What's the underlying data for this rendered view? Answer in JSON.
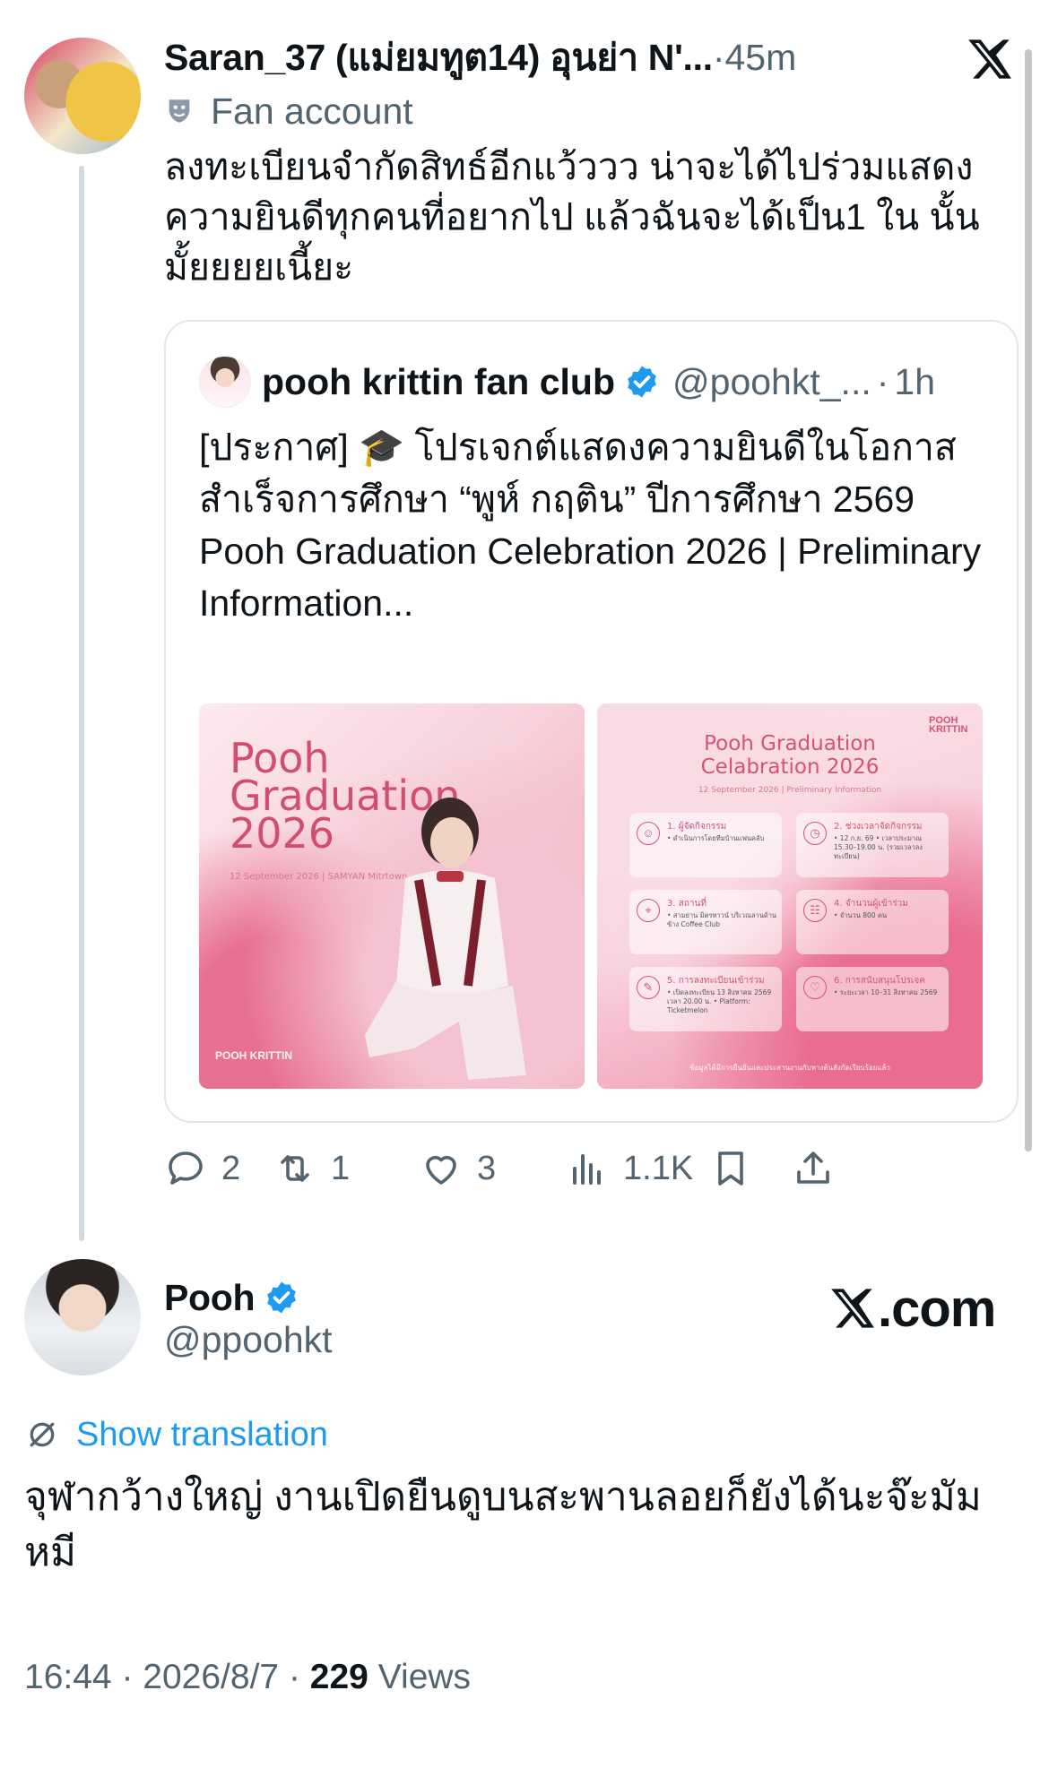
{
  "top_tweet": {
    "display_name": "Saran_37 (แม่ยมทูต14) อุนย่า N'...",
    "separator": "·",
    "time": "45m",
    "label": "Fan account",
    "text": "ลงทะเบียนจำกัดสิทธ์อีกแว้ววว น่าจะได้ไปร่วมแสดงความยินดีทุกคนที่อยากไป แล้วฉันจะได้เป็น1 ใน นั้นมั้ยยยยเนี้ยะ"
  },
  "quote": {
    "name": "pooh krittin fan club",
    "handle": "@poohkt_...",
    "separator": "·",
    "time": "1h",
    "text": "[ประกาศ] 🎓 โปรเจกต์แสดงความยินดีในโอกาสสำเร็จการศึกษา “พูห์ กฤติน” ปีการศึกษา 2569\nPooh Graduation Celebration 2026 | Preliminary Information...",
    "image1": {
      "title_line1": "Pooh",
      "title_line2": "Graduation",
      "title_line3": "2026",
      "date": "12 September 2026 | SAMYAN Mitrtown",
      "logo": "POOH KRITTIN"
    },
    "image2": {
      "title_line1": "Pooh Graduation",
      "title_line2": "Celabration 2026",
      "subtitle": "12 September 2026 | Preliminary Information",
      "logo": "POOH KRITTIN",
      "cards": [
        {
          "icon": "user-icon",
          "glyph": "☺",
          "title": "1. ผู้จัดกิจกรรม",
          "desc": "• ดำเนินการโดยทีมบ้านแฟนคลับ"
        },
        {
          "icon": "clock-icon",
          "glyph": "◷",
          "title": "2. ช่วงเวลาจัดกิจกรรม",
          "desc": "• 12 ก.ย. 69 • เวลาประมาณ 15.30–19.00 น. (รวมเวลาลงทะเบียน)"
        },
        {
          "icon": "location-icon",
          "glyph": "⌖",
          "title": "3. สถานที่",
          "desc": "• สามย่าน มิตรทาวน์ บริเวณลานด้านข้าง Coffee Club"
        },
        {
          "icon": "group-icon",
          "glyph": "☷",
          "title": "4. จำนวนผู้เข้าร่วม",
          "desc": "• จำนวน 800 คน"
        },
        {
          "icon": "edit-icon",
          "glyph": "✎",
          "title": "5. การลงทะเบียนเข้าร่วม",
          "desc": "• เปิดลงทะเบียน 13 สิงหาคม 2569 เวลา 20.00 น. • Platform: Ticketmelon"
        },
        {
          "icon": "heart-icon",
          "glyph": "♡",
          "title": "6. การสนับสนุนโปรเจค",
          "desc": "• ระยะเวลา 10–31 สิงหาคม 2569"
        }
      ],
      "footer": "ข้อมูลได้มีการยืนยันและประสานงานกับทางต้นสังกัดเรียบร้อยแล้ว"
    }
  },
  "actions": {
    "replies": "2",
    "reposts": "1",
    "likes": "3",
    "views": "1.1K"
  },
  "main_tweet": {
    "display_name": "Pooh",
    "handle": "@ppoohkt",
    "brand": ".com",
    "show_translation": "Show translation",
    "text": "จุฬากว้างใหญ่ งานเปิดยืนดูบนสะพานลอยก็ยังได้นะจ๊ะมัมหมี",
    "time": "16:44",
    "date": "2026/8/7",
    "separator": "·",
    "views_count": "229",
    "views_label": "Views"
  },
  "colors": {
    "accent": "#1d9bf0",
    "muted": "#536471",
    "text": "#0f1419",
    "poster_pink": "#d14e6f"
  }
}
